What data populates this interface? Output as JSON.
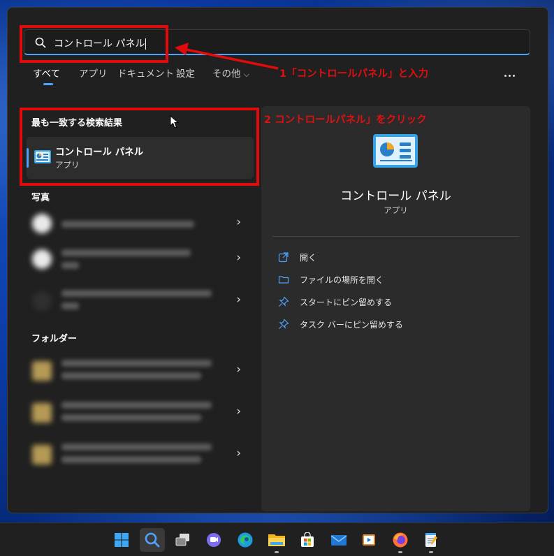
{
  "search": {
    "value": "コントロール パネル"
  },
  "tabs": [
    {
      "label": "すべて"
    },
    {
      "label": "アプリ"
    },
    {
      "label": "ドキュメント"
    },
    {
      "label": "設定"
    },
    {
      "label": "その他"
    }
  ],
  "more_label": "…",
  "best_match": {
    "heading": "最も一致する検索結果",
    "title": "コントロール パネル",
    "subtitle": "アプリ"
  },
  "photos_heading": "写真",
  "folders_heading": "フォルダー",
  "preview": {
    "title": "コントロール パネル",
    "subtitle": "アプリ",
    "actions": [
      {
        "label": "開く",
        "icon": "open-icon"
      },
      {
        "label": "ファイルの場所を開く",
        "icon": "folder-icon"
      },
      {
        "label": "スタートにピン留めする",
        "icon": "pin-icon"
      },
      {
        "label": "タスク バーにピン留めする",
        "icon": "pin-icon"
      }
    ]
  },
  "annotations": {
    "step1": "1「コントロールパネル」と入力",
    "step2": "2 コントロールパネル」をクリック",
    "color": "#e01010"
  },
  "taskbar": [
    {
      "name": "start-icon"
    },
    {
      "name": "search-icon"
    },
    {
      "name": "task-view-icon"
    },
    {
      "name": "chat-icon"
    },
    {
      "name": "edge-icon"
    },
    {
      "name": "file-explorer-icon"
    },
    {
      "name": "store-icon"
    },
    {
      "name": "mail-icon"
    },
    {
      "name": "media-player-icon"
    },
    {
      "name": "firefox-icon"
    },
    {
      "name": "notepad-icon"
    }
  ],
  "colors": {
    "accent": "#4ea3ff",
    "panel": "#202020",
    "annotation": "#e10b0b"
  }
}
